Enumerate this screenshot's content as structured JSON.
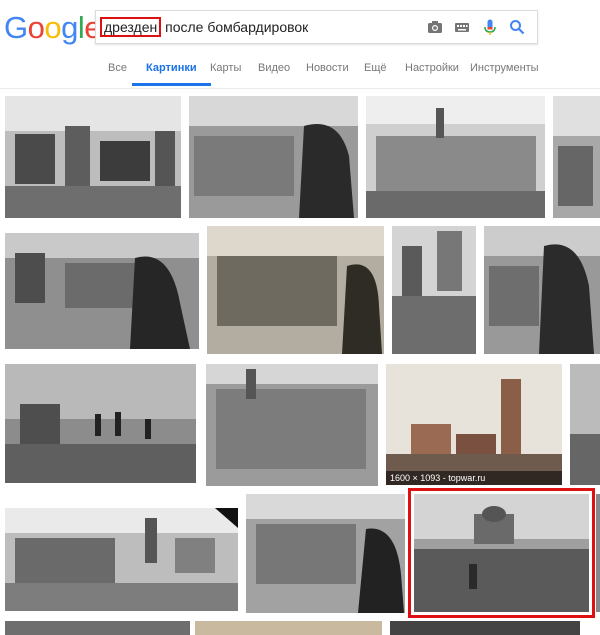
{
  "logo": {
    "text": "Google",
    "colors": [
      "#4285F4",
      "#EA4335",
      "#FBBC05",
      "#4285F4",
      "#34A853",
      "#EA4335"
    ]
  },
  "search": {
    "query_highlight": "дрезден",
    "query_rest": " после бомбардировок",
    "icons": [
      "camera-icon",
      "keyboard-icon",
      "microphone-icon",
      "search-icon"
    ]
  },
  "tabs": [
    "Все",
    "Картинки",
    "Карты",
    "Видео",
    "Новости",
    "Ещё",
    "Настройки",
    "Инструменты"
  ],
  "active_tab": "Картинки",
  "results": {
    "caption_1600": "1600 × 1093 - topwar.ru"
  },
  "colors": {
    "accent": "#1a73e8",
    "highlight": "#dd1111"
  }
}
